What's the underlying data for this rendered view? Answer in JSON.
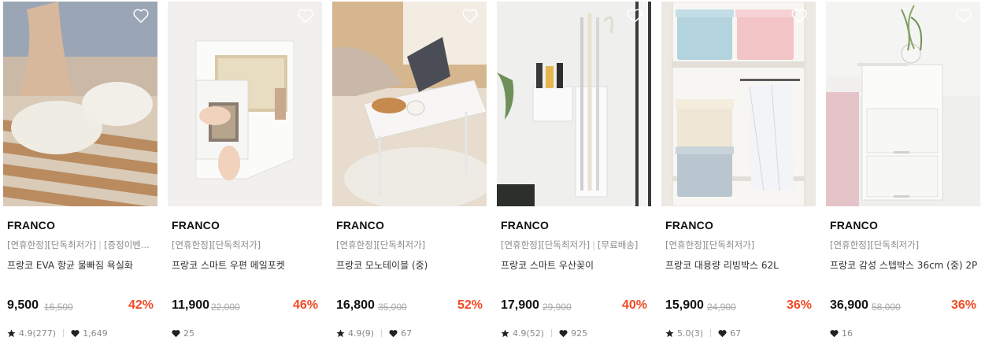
{
  "products": [
    {
      "brand": "FRANCO",
      "tags": "[연휴한정][단독최저가]",
      "tags_extra": "[증정이벤...",
      "name": "프랑코 EVA 항균 물빠짐 욕실화",
      "price": "9,500",
      "original_price": "16,500",
      "discount": "42%",
      "rating": "4.9(277)",
      "likes": "1,649"
    },
    {
      "brand": "FRANCO",
      "tags": "[연휴한정][단독최저가]",
      "tags_extra": "",
      "name": "프랑코 스마트 우편 메일포켓",
      "price": "11,900",
      "original_price": "22,000",
      "discount": "46%",
      "rating": "",
      "likes": "25"
    },
    {
      "brand": "FRANCO",
      "tags": "[연휴한정][단독최저가]",
      "tags_extra": "",
      "name": "프랑코 모노테이블 (중)",
      "price": "16,800",
      "original_price": "35,000",
      "discount": "52%",
      "rating": "4.9(9)",
      "likes": "67"
    },
    {
      "brand": "FRANCO",
      "tags": "[연휴한정][단독최저가]",
      "tags_extra": "[무료배송]",
      "name": "프랑코 스마트 우산꽂이",
      "price": "17,900",
      "original_price": "29,900",
      "discount": "40%",
      "rating": "4.9(52)",
      "likes": "925"
    },
    {
      "brand": "FRANCO",
      "tags": "[연휴한정][단독최저가]",
      "tags_extra": "",
      "name": "프랑코 대용량 리빙박스 62L",
      "price": "15,900",
      "original_price": "24,900",
      "discount": "36%",
      "rating": "5.0(3)",
      "likes": "67"
    },
    {
      "brand": "FRANCO",
      "tags": "[연휴한정][단독최저가]",
      "tags_extra": "",
      "name": "프랑코 감성 스텝박스 36cm (중) 2P",
      "price": "36,900",
      "original_price": "58,000",
      "discount": "36%",
      "rating": "",
      "likes": "16"
    }
  ],
  "icons": {
    "wishlist": "heart-outline-icon",
    "rating": "star-icon",
    "likes": "heart-icon"
  },
  "colors": {
    "discount": "#f04a24",
    "brand_text": "#111111",
    "muted": "#8a8a8a"
  }
}
